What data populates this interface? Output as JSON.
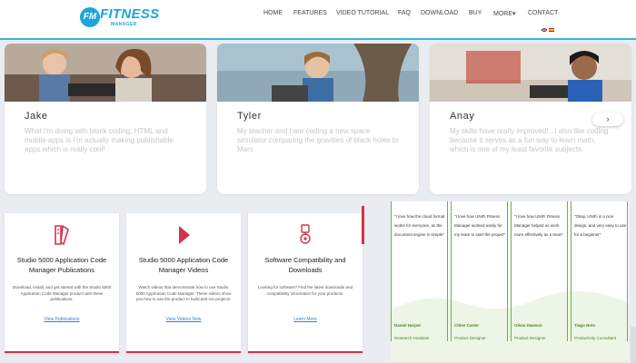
{
  "header": {
    "logo_word": "FITNESS",
    "logo_badge": "FM",
    "logo_sub": "MANAGER",
    "nav": [
      {
        "label": "HOME"
      },
      {
        "label": "FEATURES"
      },
      {
        "label": "VIDEO TUTORIAL"
      },
      {
        "label": "FAQ"
      },
      {
        "label": "DOWNLOAD"
      },
      {
        "label": "BUY"
      },
      {
        "label": "MORE▾"
      },
      {
        "label": "CONTACT"
      }
    ],
    "colors": {
      "accent": "#1aa6d8",
      "underline": "#39b7d6"
    }
  },
  "testimonials": [
    {
      "name": "Jake",
      "quote": "What I'm doing with block coding, HTML and mobile apps is I'm actually making publishable apps which is really cool!"
    },
    {
      "name": "Tyler",
      "quote": "My teacher and I are coding a new space simulator comparing the gravities of black holes to Mars."
    },
    {
      "name": "Anay",
      "quote": "My skills have really improved!...I also like coding because it serves as a fun way to learn math, which is one of my least favorite subjects."
    }
  ],
  "carousel_next": "›",
  "resources": [
    {
      "icon": "book-icon",
      "title": "Studio 5000 Application Code Manager Publications",
      "desc": "Download, install, and get started with the Studio 5000 Application Code Manager product with these publications.",
      "link": "View Publications"
    },
    {
      "icon": "play-icon",
      "title": "Studio 5000 Application Code Manager Videos",
      "desc": "Watch videos that demonstrate how to use Studio 5000 Application Code Manager. These videos show you how to use the product to build and run projects.",
      "link": "View Videos Now"
    },
    {
      "icon": "compatibility-icon",
      "title": "Software Compatibility and Downloads",
      "desc": "Looking for software? Find the latest downloads and compatibility information for your products.",
      "link": "Learn More"
    }
  ],
  "quotes": [
    {
      "text": "\"I love how the cloud format works for everyone, as the document engine is simple\"",
      "name": "Daniel Harper",
      "role": "Research Assistant"
    },
    {
      "text": "\"I love how UNiFi Fitness Manager worked easily for my team to start the project\"",
      "name": "Chloe Carter",
      "role": "Product Designer"
    },
    {
      "text": "\"I love how UNiFi Fitness Manager helped us work more effectively as a team\"",
      "name": "Olivia Dawson",
      "role": "Product Designer"
    },
    {
      "text": "\"Okay, UNiFi is a nice design, and very easy to use for a beginner\"",
      "name": "Tiago Neto",
      "role": "Productivity Consultant"
    }
  ]
}
